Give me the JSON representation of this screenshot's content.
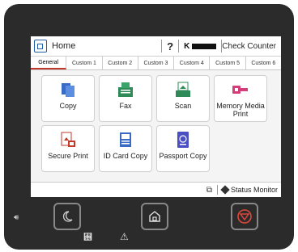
{
  "header": {
    "home_label": "Home",
    "help_glyph": "?",
    "toner_label": "K",
    "counter_label": "Check Counter"
  },
  "tabs": [
    "General",
    "Custom 1",
    "Custom 2",
    "Custom 3",
    "Custom 4",
    "Custom 5",
    "Custom 6"
  ],
  "tiles": [
    {
      "label": "Copy",
      "icon": "copy-icon"
    },
    {
      "label": "Fax",
      "icon": "fax-icon"
    },
    {
      "label": "Scan",
      "icon": "scan-icon"
    },
    {
      "label": "Memory Media Print",
      "icon": "usb-icon"
    },
    {
      "label": "Secure Print",
      "icon": "lock-document-icon"
    },
    {
      "label": "ID Card Copy",
      "icon": "id-card-icon"
    },
    {
      "label": "Passport Copy",
      "icon": "passport-icon"
    }
  ],
  "footer": {
    "status_label": "Status Monitor"
  },
  "colors": {
    "accent": "#1f5fa8",
    "tab_active": "#c0392b",
    "stop": "#e0483a"
  }
}
